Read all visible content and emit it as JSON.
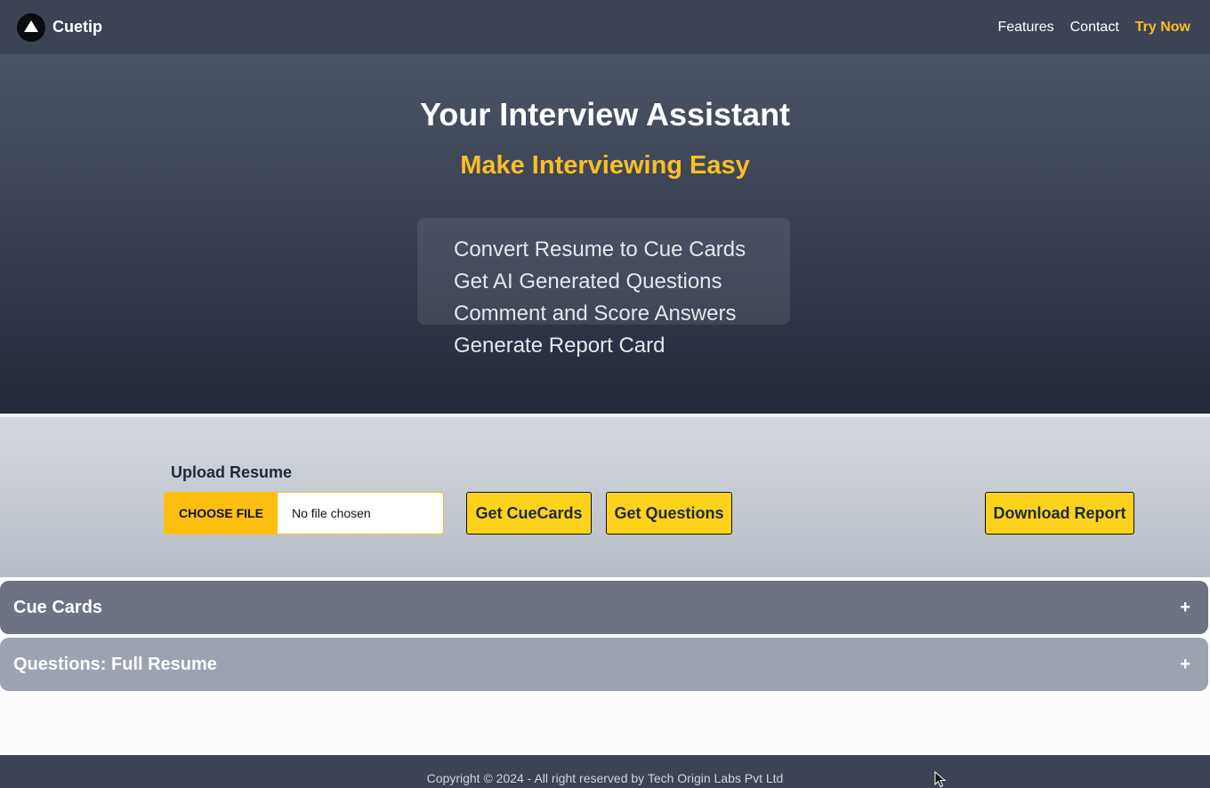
{
  "nav": {
    "brand": "Cuetip",
    "links": [
      "Features",
      "Contact"
    ],
    "cta": "Try Now"
  },
  "hero": {
    "title": "Your Interview Assistant",
    "subtitle": "Make Interviewing Easy",
    "features": [
      "Convert Resume to Cue Cards",
      "Get AI Generated Questions",
      "Comment and Score Answers",
      "Generate Report Card"
    ]
  },
  "upload": {
    "label": "Upload Resume",
    "choose_file": "CHOOSE FILE",
    "file_status": "No file chosen",
    "get_cuecards": "Get CueCards",
    "get_questions": "Get Questions",
    "download_report": "Download Report"
  },
  "accordions": [
    {
      "title": "Cue Cards",
      "toggle": "+"
    },
    {
      "title": "Questions: Full Resume",
      "toggle": "+"
    }
  ],
  "footer": {
    "text": "Copyright © 2024 - All right reserved by Tech Origin Labs Pvt Ltd"
  },
  "colors": {
    "accent": "#fbbf24",
    "nav_bg": "#3b4355",
    "button_yellow": "#fcd21c"
  }
}
